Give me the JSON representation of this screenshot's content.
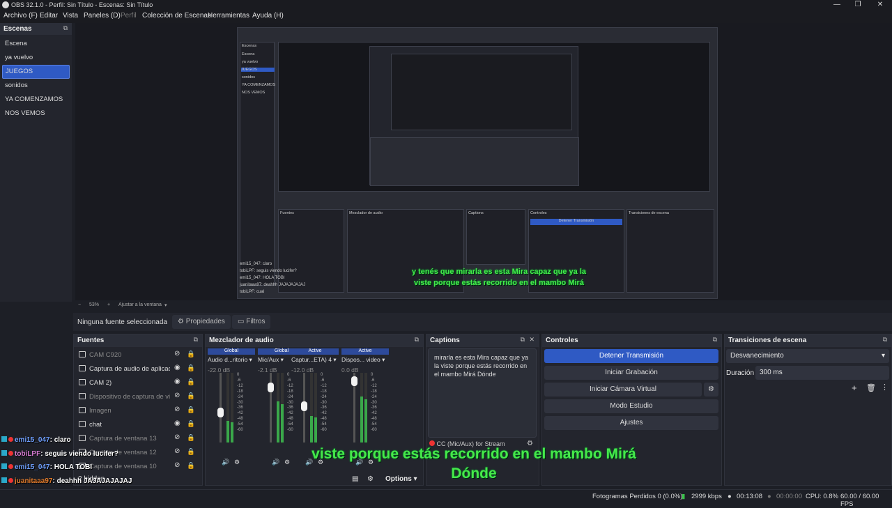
{
  "window": {
    "title": "OBS 32.1.0 - Perfil: Sin Título - Escenas: Sin Título",
    "min": "—",
    "max": "❐",
    "close": "✕"
  },
  "menu": [
    "Archivo (F)",
    "Editar",
    "Vista",
    "Paneles (D)",
    "Perfil",
    "Colección de Escenas",
    "Herramientas",
    "Ayuda (H)"
  ],
  "scenes": {
    "title": "Escenas",
    "items": [
      "Escena",
      "ya vuelvo",
      "JUEGOS",
      "sonidos",
      "YA COMENZAMOS",
      "NOS VEMOS"
    ],
    "selected": "JUEGOS"
  },
  "zoom": {
    "value": "53%",
    "fit": "Ajustar a la ventana"
  },
  "propbar": {
    "no_source": "Ninguna fuente seleccionada",
    "properties": "Propiedades",
    "filters": "Filtros"
  },
  "sources": {
    "title": "Fuentes",
    "items": [
      {
        "label": "CAM C920",
        "visible": false
      },
      {
        "label": "Captura de audio de aplicación",
        "visible": true
      },
      {
        "label": "CAM 2)",
        "visible": true
      },
      {
        "label": "Dispositivo de captura de video",
        "visible": false
      },
      {
        "label": "Imagen",
        "visible": false
      },
      {
        "label": "chat",
        "visible": true
      },
      {
        "label": "Captura de ventana 13",
        "visible": false
      },
      {
        "label": "Captura de ventana 12",
        "visible": false
      },
      {
        "label": "Captura de ventana 10",
        "visible": false
      }
    ],
    "hidden": "2 hidden"
  },
  "mixer": {
    "title": "Mezclador de audio",
    "options": "Options",
    "channels": [
      {
        "tag": "Global",
        "name": "Audio d...ritorio",
        "db": "-22.0 dB",
        "level": 0.45
      },
      {
        "tag": "Global",
        "name": "Mic/Aux",
        "db": "-2.1 dB",
        "level": 0.85
      },
      {
        "tag": "Active",
        "name": "Captur...ETA) 4",
        "db": "-12.0 dB",
        "level": 0.55
      },
      {
        "tag": "Active",
        "name": "Dispos... video",
        "db": "0.0 dB",
        "level": 0.95
      }
    ],
    "scale": [
      "0",
      "-6",
      "-12",
      "-18",
      "-24",
      "-30",
      "-36",
      "-42",
      "-48",
      "-54",
      "-60"
    ]
  },
  "captions": {
    "title": "Captions",
    "text": "mirarla es esta Mira capaz que ya la viste porque estás recorrido en el mambo Mirá Dónde",
    "source": "CC (Mic/Aux) for Stream"
  },
  "controls": {
    "title": "Controles",
    "stop_stream": "Detener Transmisión",
    "start_rec": "Iniciar Grabación",
    "virtual_cam": "Iniciar Cámara Virtual",
    "studio": "Modo Estudio",
    "settings": "Ajustes"
  },
  "transitions": {
    "title": "Transiciones de escena",
    "type": "Desvanecimiento",
    "duration_label": "Duración",
    "duration": "300 ms"
  },
  "status": {
    "dropped": "Fotogramas Perdidos 0 (0.0%)",
    "kbps": "2999 kbps",
    "live_time": "00:13:08",
    "rec_time": "00:00:00",
    "cpu": "CPU: 0.8%",
    "fps": "60.00 / 60.00 FPS"
  },
  "subtitle": {
    "main_line1": "viste porque estás recorrido en el mambo Mirá",
    "main_line2": "Dónde",
    "inner_line1": "y tenés que mirarla es esta Mira capaz que ya la",
    "inner_line2": "viste porque estás recorrido en el mambo Mirá"
  },
  "chat": [
    {
      "user": "emi15_047",
      "msg": ": claro"
    },
    {
      "user": "tobiLPF",
      "msg": ": seguis viendo lucifer?"
    },
    {
      "user": "emi15_047",
      "msg": ": HOLA TOBI"
    },
    {
      "user": "juanitaaa97",
      "msg": ": deahhh JAJAJAJAJAJ"
    },
    {
      "user": "tobiLPF",
      "msg": ": cual"
    }
  ]
}
